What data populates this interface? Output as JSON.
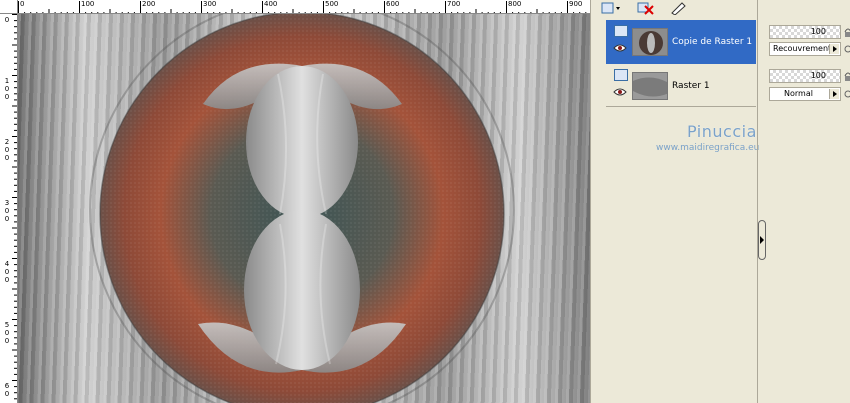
{
  "ruler": {
    "top_labels": [
      "0",
      "100",
      "200",
      "300",
      "400",
      "500",
      "600",
      "700",
      "800",
      "900"
    ],
    "left_labels": [
      "0",
      "1\n0\n0",
      "2\n0\n0",
      "3\n0\n0",
      "4\n0\n0",
      "5\n0\n0",
      "6\n0"
    ]
  },
  "toolbar": {
    "new_layer_icon": "layer-new-icon",
    "delete_layer_icon": "delete-icon",
    "edit_icon": "pen-icon"
  },
  "layers": [
    {
      "name": "Copie de Raster 1",
      "selected": true,
      "opacity": "100",
      "blend_mode": "Recouvrement"
    },
    {
      "name": "Raster 1",
      "selected": false,
      "opacity": "100",
      "blend_mode": "Normal"
    }
  ],
  "watermark": {
    "title": "Pinuccia",
    "url": "www.maidiregrafica.eu"
  },
  "colors": {
    "selected_row": "#316ac5",
    "panel_bg": "#ece9d8",
    "rust": "#a4533a",
    "watermark": "#7ba2c9"
  }
}
